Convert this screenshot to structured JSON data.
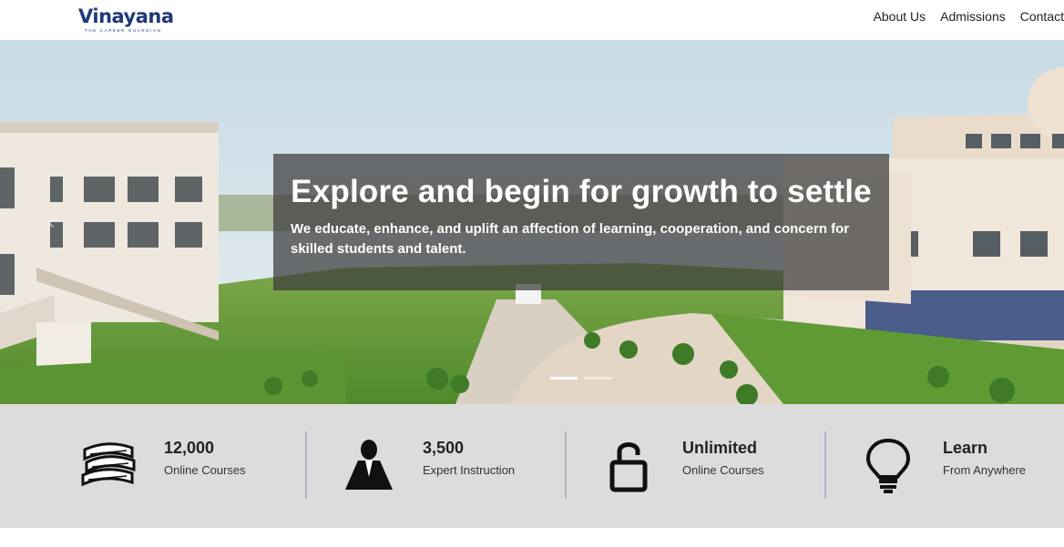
{
  "header": {
    "logo_text": "Vinayana",
    "logo_tagline": "THE CAREER GUARDIAN",
    "nav": [
      "About Us",
      "Admissions",
      "Contact"
    ]
  },
  "hero": {
    "title": "Explore and begin for growth to settle",
    "subtitle": "We educate, enhance, and uplift an affection of learning, cooperation, and concern for skilled students and talent.",
    "slide_count": 2,
    "active_slide": 1
  },
  "stats": [
    {
      "number": "12,000",
      "label": "Online Courses",
      "icon": "books-icon"
    },
    {
      "number": "3,500",
      "label": "Expert Instruction",
      "icon": "instructor-icon"
    },
    {
      "number": "Unlimited",
      "label": "Online Courses",
      "icon": "unlock-icon"
    },
    {
      "number": "Learn",
      "label": "From Anywhere",
      "icon": "lightbulb-icon"
    }
  ],
  "colors": {
    "brand": "#1f3a78",
    "stats_bg": "#dcdcdc",
    "divider": "#b5b5c4"
  }
}
